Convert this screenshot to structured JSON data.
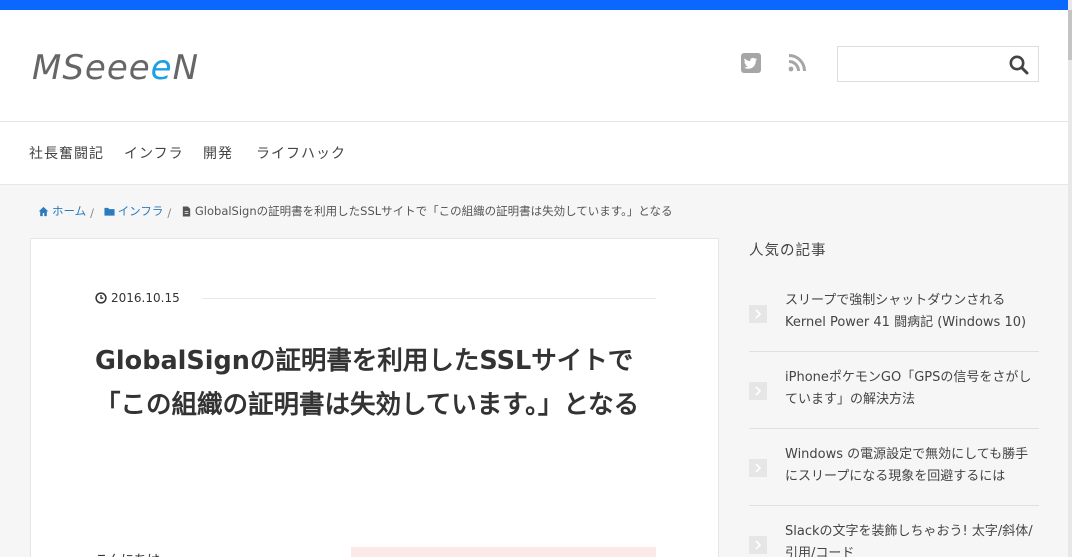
{
  "site": {
    "logo_prefix": "MSeee",
    "logo_accent": "e",
    "logo_suffix": "N",
    "accent_color": "#1ba1e2",
    "topbar_color": "#0a67ff"
  },
  "header": {
    "icons": [
      "twitter-icon",
      "rss-icon"
    ],
    "search": {
      "placeholder": "",
      "value": "",
      "icon": "search-icon"
    }
  },
  "nav": {
    "items": [
      {
        "label": "社長奮闘記"
      },
      {
        "label": "インフラ"
      },
      {
        "label": "開発"
      },
      {
        "label": "ライフハック"
      }
    ]
  },
  "breadcrumb": {
    "home": "ホーム",
    "category": "インフラ",
    "current": "GlobalSignの証明書を利用したSSLサイトで「この組織の証明書は失効しています。」となる",
    "separator": "/"
  },
  "article": {
    "date": "2016.10.15",
    "title": "GlobalSignの証明書を利用したSSLサイトで「この組織の証明書は失効しています。」となる",
    "intro": "こんにちは"
  },
  "sidebar": {
    "title": "人気の記事",
    "items": [
      {
        "label": "スリープで強制シャットダウンされる Kernel Power 41 闘病記 (Windows 10)"
      },
      {
        "label": "iPhoneポケモンGO「GPSの信号をさがしています」の解決方法"
      },
      {
        "label": "Windows の電源設定で無効にしても勝手にスリープになる現象を回避するには"
      },
      {
        "label": "Slackの文字を装飾しちゃおう! 太字/斜体/引用/コード"
      }
    ]
  }
}
